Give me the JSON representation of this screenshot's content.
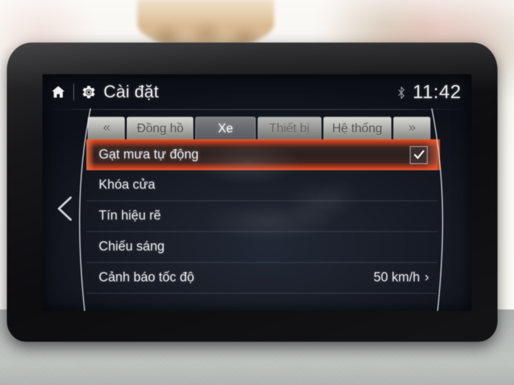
{
  "device": {
    "kind": "car-infotainment-head-unit",
    "bezel_color": "#141416",
    "screen_bg_color": "#171b25"
  },
  "header": {
    "home_icon": "home-icon",
    "settings_icon": "gear-icon",
    "title": "Cài đặt",
    "bluetooth_icon": "bluetooth-icon",
    "clock": "11:42"
  },
  "nav": {
    "back_icon": "back-chevron-icon",
    "prev_tab_label": "«",
    "next_tab_label": "»"
  },
  "tabs": [
    {
      "id": "dong-ho",
      "label": "Đồng hồ",
      "active": false
    },
    {
      "id": "xe",
      "label": "Xe",
      "active": true
    },
    {
      "id": "thiet-bi",
      "label": "Thiết bị",
      "active": false,
      "dim": true
    },
    {
      "id": "he-thong",
      "label": "Hệ thống",
      "active": false
    }
  ],
  "list": {
    "rows": [
      {
        "id": "gat-mua-tu-dong",
        "label": "Gạt mưa tự động",
        "selected": true,
        "control": "checkbox",
        "checked": true,
        "value": ""
      },
      {
        "id": "khoa-cua",
        "label": "Khóa cửa",
        "selected": false,
        "control": "none",
        "value": ""
      },
      {
        "id": "tin-hieu-re",
        "label": "Tín hiệu rẽ",
        "selected": false,
        "control": "none",
        "value": ""
      },
      {
        "id": "chieu-sang",
        "label": "Chiếu sáng",
        "selected": false,
        "control": "none",
        "value": ""
      },
      {
        "id": "canh-bao-toc-do",
        "label": "Cảnh báo tốc độ",
        "selected": false,
        "control": "value-caret",
        "value": "50 km/h",
        "caret": "›"
      }
    ]
  },
  "colors": {
    "selection_red": "#e8532b",
    "selection_red_bright": "#ef5a2e",
    "text_primary": "#eceff3",
    "tab_inactive_text": "#4b4b4b",
    "tab_active_text": "#ffffff"
  }
}
